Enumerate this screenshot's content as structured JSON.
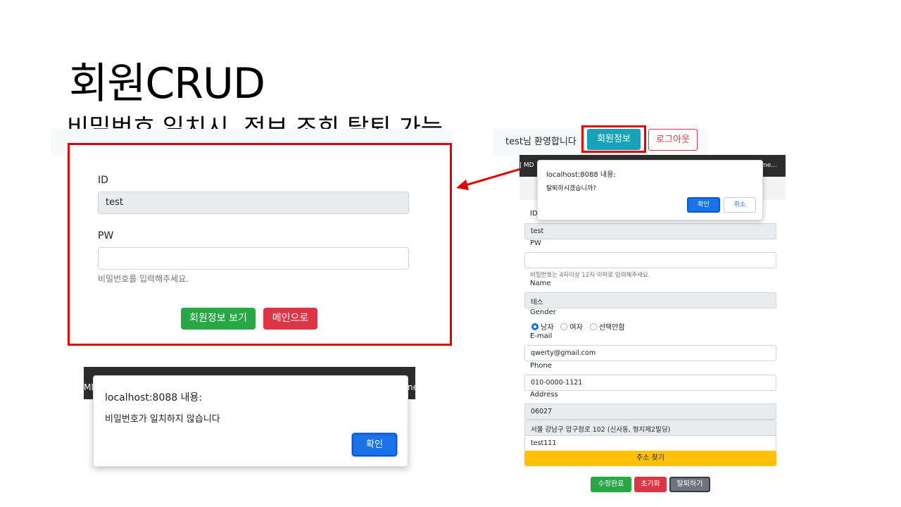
{
  "slide": {
    "title": "회원CRUD",
    "subtitle": "비밀번호 일치시, 정보 조회,탈퇴 가능"
  },
  "left_form": {
    "id_label": "ID",
    "id_value": "test",
    "pw_label": "PW",
    "pw_value": "",
    "pw_help": "비밀번호를 입력해주세요.",
    "view_button": "회원정보 보기",
    "main_button": "메인으로"
  },
  "left_alert": {
    "bar_left_text": "MD",
    "bar_right_text": "ne",
    "title": "localhost:8088 내용:",
    "message": "비밀번호가 일치하지 않습니다",
    "ok_label": "확인"
  },
  "navbar": {
    "welcome": "test님 환영합니다",
    "member_info_button": "회원정보",
    "logout_button": "로그아웃"
  },
  "right_alert": {
    "bar_left_text": "| MD",
    "bar_right_text": "ne...",
    "title": "localhost:8088 내용:",
    "message": "탈퇴하시겠습니까?",
    "ok_label": "확인",
    "cancel_label": "취소"
  },
  "right_form": {
    "id_label": "ID",
    "id_value": "test",
    "pw_label": "PW",
    "pw_value": "",
    "pw_help": "비밀번호는 4자이상 12자 이하로 입력해주세요.",
    "name_label": "Name",
    "name_value": "테스",
    "gender_label": "Gender",
    "gender_options": [
      "남자",
      "여자",
      "선택안함"
    ],
    "gender_selected": "남자",
    "email_label": "E-mail",
    "email_value": "qwerty@gmail.com",
    "phone_label": "Phone",
    "phone_value": "010-0000-1121",
    "address_label": "Address",
    "zipcode": "06027",
    "address": "서울 강남구 압구정로 102 (신사동, 형지제2빌딩)",
    "address_detail": "test111",
    "find_address_button": "주소 찾기",
    "save_button": "수정완료",
    "reset_button": "초기화",
    "withdraw_button": "탈퇴하기"
  },
  "colors": {
    "highlight_red": "#e00000",
    "success": "#28a745",
    "danger": "#dc3545",
    "info": "#17a2b8",
    "warning": "#ffc107",
    "secondary": "#6c757d",
    "dialog_blue": "#1a73e8"
  }
}
